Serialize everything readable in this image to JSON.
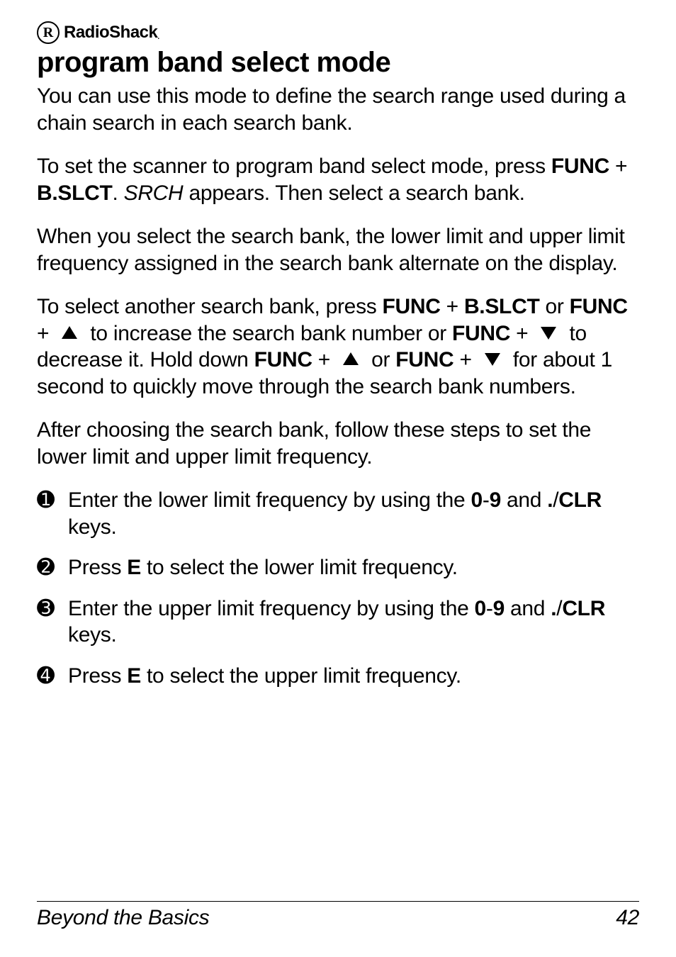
{
  "brand": {
    "r": "R",
    "name": "RadioShack",
    "dot": "."
  },
  "title": "program band select mode",
  "paragraphs": {
    "p1": "You can use this mode to define the search range used during a chain search in each search bank.",
    "p2_a": "To set the scanner to program band select mode, press ",
    "p2_func": "FUNC",
    "p2_plus": " + ",
    "p2_bslct": "B.SLCT",
    "p2_period": ". ",
    "p2_srch": "SRCH",
    "p2_b": " appears. Then select a search bank.",
    "p3": "When you select the search bank, the lower limit and upper limit frequency assigned in the search bank alternate on the display.",
    "p4_a": "To select another search bank, press ",
    "p4_func1": "FUNC",
    "p4_plus1": " + ",
    "p4_bslct": "B.SLCT",
    "p4_or1": " or ",
    "p4_func2": "FUNC",
    "p4_plus2": " + ",
    "p4_b": " to increase the search bank number or ",
    "p4_func3": "FUNC",
    "p4_plus3": " + ",
    "p4_c": " to decrease it. Hold down ",
    "p4_func4": "FUNC",
    "p4_plus4": " + ",
    "p4_or2": " or ",
    "p4_func5": "FUNC",
    "p4_plus5": " + ",
    "p4_d": " for about 1 second to quickly move through the search bank numbers.",
    "p5": "After choosing the search bank, follow these steps to set the lower limit and upper limit frequency."
  },
  "steps": [
    {
      "num": "➊",
      "a": "Enter the lower limit frequency by using the ",
      "keys1": "0",
      "dash": "-",
      "keys2": "9",
      "b": " and ",
      "keys3": ".",
      "slash": "/",
      "keys4": "CLR",
      "c": " keys."
    },
    {
      "num": "➋",
      "a": "Press ",
      "keys1": "E",
      "b": " to select the lower limit frequency."
    },
    {
      "num": "➌",
      "a": "Enter the upper limit frequency by using the ",
      "keys1": "0",
      "dash": "-",
      "keys2": "9",
      "b": " and ",
      "keys3": ".",
      "slash": "/",
      "keys4": "CLR",
      "c": " keys."
    },
    {
      "num": "➍",
      "a": "Press ",
      "keys1": "E",
      "b": " to select the upper limit frequency."
    }
  ],
  "footer": {
    "section": "Beyond the Basics",
    "page": "42"
  }
}
